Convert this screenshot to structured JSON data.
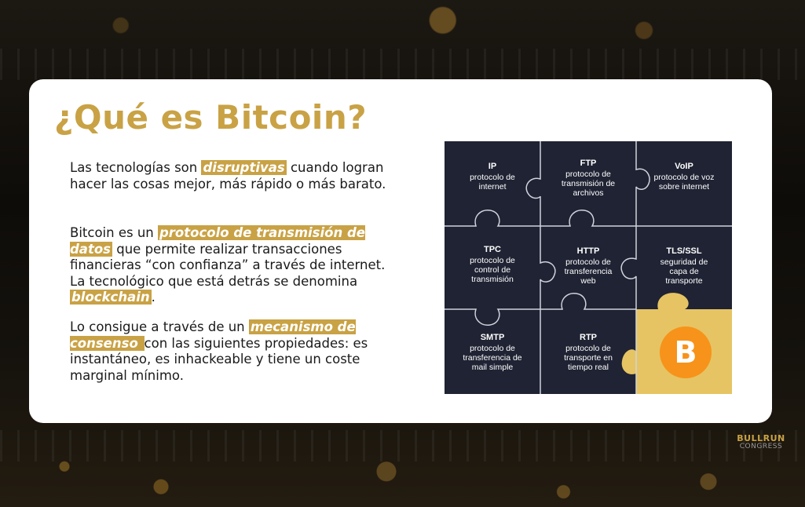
{
  "slide": {
    "title": "¿Qué es Bitcoin?",
    "p1": {
      "before": "Las tecnologías son ",
      "highlight": "disruptivas",
      "after": " cuando logran hacer las cosas mejor, más rápido o más barato."
    },
    "p2": {
      "before": "Bitcoin es un ",
      "highlight1": "protocolo de transmisión de datos",
      "middle": " que permite realizar transacciones financieras “con confianza” a través de internet. La tecnológico que está detrás se denomina ",
      "highlight2": "blockchain",
      "after": "."
    },
    "p3": {
      "before": "Lo consigue a través de un ",
      "highlight": "mecanismo de consenso ",
      "after": " con las siguientes propiedades: es instantáneo, es inhackeable y tiene un coste marginal mínimo."
    }
  },
  "puzzle": {
    "cells": [
      {
        "abbr": "IP",
        "desc": "protocolo de internet"
      },
      {
        "abbr": "FTP",
        "desc": "protocolo de transmisión de archivos"
      },
      {
        "abbr": "VoIP",
        "desc": "protocolo de voz sobre internet"
      },
      {
        "abbr": "TPC",
        "desc": "protocolo de control de transmisión"
      },
      {
        "abbr": "HTTP",
        "desc": "protocolo de transferencia web"
      },
      {
        "abbr": "TLS/SSL",
        "desc": "seguridad de capa de transporte"
      },
      {
        "abbr": "SMTP",
        "desc": "protocolo de transferencia de mail simple"
      },
      {
        "abbr": "RTP",
        "desc": "protocolo de transporte en tiempo real"
      }
    ],
    "bitcoin_symbol": "B",
    "highlight_color": "#e6c463",
    "dark_color": "#1f2333"
  },
  "brand": {
    "line1": "BULLRUN",
    "line2": "CONGRESS"
  }
}
